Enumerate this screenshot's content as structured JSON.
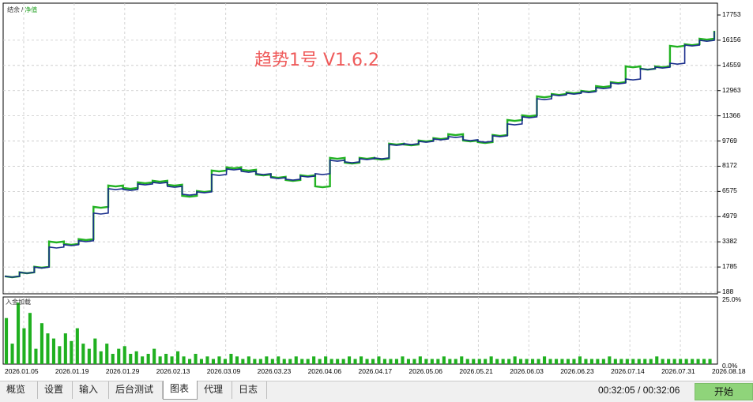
{
  "legend": {
    "balance": "结余",
    "separator": "/",
    "equity": "净值"
  },
  "sub_legend": "入金加载",
  "watermark": "趋势1号 V1.6.2",
  "colors": {
    "balance_line": "#1a2e8c",
    "equity_line": "#22b222",
    "volume_bar": "#20b020",
    "grid": "#c8c8c8",
    "watermark": "#ef5a5a",
    "start_button": "#8fd47a"
  },
  "chart_data": [
    {
      "type": "line",
      "series": [
        {
          "name": "结余",
          "values": [
            1200,
            1450,
            1780,
            3050,
            3200,
            3450,
            5200,
            6750,
            6700,
            7050,
            7150,
            6900,
            6400,
            6550,
            7650,
            8000,
            7850,
            7700,
            7450,
            7350,
            7550,
            7700,
            8550,
            8450,
            8650,
            8700,
            9550,
            9600,
            9750,
            9900,
            10050,
            9850,
            9750,
            10100,
            10850,
            11300,
            12450,
            12700,
            12800,
            12900,
            13150,
            13450,
            13700,
            14350,
            14450,
            14700,
            15850,
            16150,
            16700
          ]
        },
        {
          "name": "净值",
          "values": [
            1200,
            1450,
            1800,
            3400,
            3250,
            3550,
            5600,
            6950,
            6800,
            7150,
            7250,
            7000,
            6300,
            6600,
            7900,
            8100,
            7950,
            7650,
            7500,
            7300,
            7600,
            6900,
            8700,
            8400,
            8700,
            8650,
            9600,
            9550,
            9800,
            9950,
            10200,
            9800,
            9700,
            10150,
            11100,
            11400,
            12600,
            12750,
            12850,
            12950,
            13250,
            13500,
            14500,
            14350,
            14500,
            15800,
            15900,
            16250,
            16750
          ]
        }
      ],
      "y_ticks": [
        "17753",
        "16156",
        "14559",
        "12963",
        "11366",
        "9769",
        "8172",
        "6575",
        "4979",
        "3382",
        "1785",
        "188"
      ],
      "ylim": [
        188,
        17753
      ],
      "grid": true
    },
    {
      "type": "bar",
      "title": "入金加载",
      "values": [
        18,
        8,
        24,
        14,
        20,
        6,
        16,
        12,
        10,
        7,
        12,
        9,
        14,
        8,
        6,
        10,
        5,
        8,
        4,
        6,
        7,
        4,
        5,
        3,
        4,
        6,
        3,
        4,
        3,
        5,
        3,
        2,
        4,
        2,
        3,
        2,
        3,
        2,
        4,
        3,
        2,
        3,
        2,
        2,
        3,
        2,
        3,
        2,
        2,
        3,
        2,
        2,
        3,
        2,
        3,
        2,
        2,
        2,
        3,
        2,
        3,
        2,
        2,
        3,
        2,
        2,
        2,
        3,
        2,
        2,
        3,
        2,
        2,
        2,
        3,
        2,
        2,
        3,
        2,
        2,
        2,
        2,
        3,
        2,
        2,
        2,
        3,
        2,
        2,
        2,
        2,
        3,
        2,
        2,
        2,
        2,
        2,
        3,
        2,
        2,
        2,
        2,
        3,
        2,
        2,
        2,
        2,
        2,
        2,
        2,
        3,
        2,
        2,
        2,
        2,
        2,
        2,
        2,
        2,
        2
      ],
      "y_ticks": [
        "25.0%",
        "0.0%"
      ],
      "ylim": [
        0,
        25
      ],
      "x_ticks": [
        "2026.01.05",
        "2026.01.19",
        "2026.01.29",
        "2026.02.13",
        "2026.03.09",
        "2026.03.23",
        "2026.04.06",
        "2026.04.17",
        "2026.05.06",
        "2026.05.21",
        "2026.06.03",
        "2026.06.23",
        "2026.07.14",
        "2026.07.31",
        "2026.08.18"
      ]
    }
  ],
  "tabs": [
    "概览",
    "设置",
    "输入",
    "后台测试",
    "图表",
    "代理",
    "日志"
  ],
  "active_tab": "图表",
  "time_display": "00:32:05 / 00:32:06",
  "start_button": "开始"
}
